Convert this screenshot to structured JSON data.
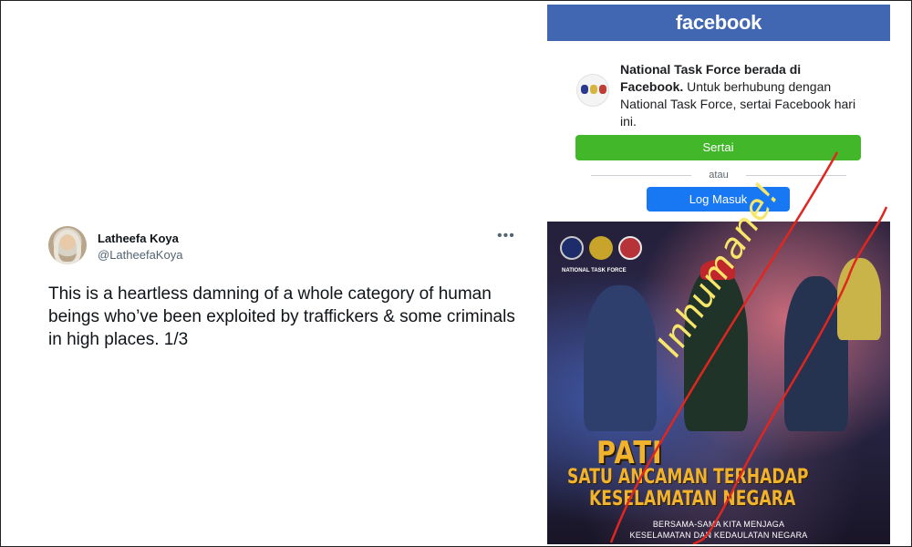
{
  "tweet": {
    "name": "Latheefa Koya",
    "handle": "@LatheefaKoya",
    "more_icon": "more-horizontal-icon",
    "text": "This is a heartless damning of a whole category of human beings who’ve been exploited by traffickers & some criminals in high places. 1/3"
  },
  "facebook": {
    "brand": "facebook",
    "page_name_bold": "National Task Force berada di Facebook.",
    "message": " Untuk berhubung dengan National Task Force, sertai Facebook hari ini.",
    "join_label": "Sertai",
    "or_label": "atau",
    "login_label": "Log Masuk",
    "colors": {
      "header": "#4267b2",
      "join": "#42b72a",
      "login": "#1877f2"
    }
  },
  "poster": {
    "agencies_caption": "NATIONAL TASK FORCE",
    "headline": "PATI",
    "line1": "SATU ANCAMAN TERHADAP",
    "line2": "KESELAMATAN NEGARA",
    "sub1": "BERSAMA-SAMA KITA MENJAGA",
    "sub2": "KESELAMATAN DAN KEDAULATAN NEGARA",
    "annotation": "Inhumane!",
    "annotation_color": "#f7e66a",
    "strike_color": "#e0261f"
  }
}
